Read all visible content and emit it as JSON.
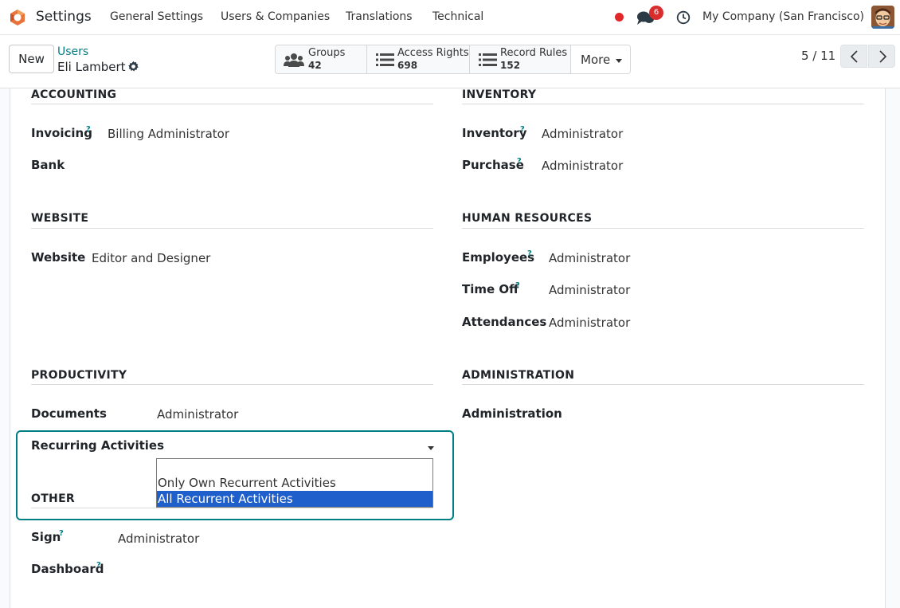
{
  "navbar": {
    "app_name": "Settings",
    "menu": [
      "General Settings",
      "Users & Companies",
      "Translations",
      "Technical"
    ],
    "chat_count": "6",
    "company": "My Company (San Francisco)"
  },
  "control": {
    "new_label": "New",
    "breadcrumb_parent": "Users",
    "breadcrumb_current": "Eli Lambert",
    "smart_buttons": [
      {
        "label": "Groups",
        "count": "42",
        "icon": "users-icon"
      },
      {
        "label": "Access Rights",
        "count": "698",
        "icon": "list-icon"
      },
      {
        "label": "Record Rules",
        "count": "152",
        "icon": "list-icon"
      }
    ],
    "more_label": "More",
    "pager": "5 / 11"
  },
  "sections": {
    "accounting": {
      "title": "ACCOUNTING",
      "fields": [
        {
          "label": "Invoicing",
          "help": "?",
          "value": "Billing Administrator"
        },
        {
          "label": "Bank",
          "help": "",
          "value": ""
        }
      ]
    },
    "inventory": {
      "title": "INVENTORY",
      "fields": [
        {
          "label": "Inventory",
          "help": "?",
          "value": "Administrator"
        },
        {
          "label": "Purchase",
          "help": "?",
          "value": "Administrator"
        }
      ]
    },
    "website": {
      "title": "WEBSITE",
      "fields": [
        {
          "label": "Website",
          "help": "",
          "value": "Editor and Designer"
        }
      ]
    },
    "human_resources": {
      "title": "HUMAN RESOURCES",
      "fields": [
        {
          "label": "Employees",
          "help": "?",
          "value": "Administrator"
        },
        {
          "label": "Time Off",
          "help": "?",
          "value": "Administrator"
        },
        {
          "label": "Attendances",
          "help": "",
          "value": "Administrator"
        }
      ]
    },
    "productivity": {
      "title": "PRODUCTIVITY",
      "fields": [
        {
          "label": "Documents",
          "help": "",
          "value": "Administrator"
        },
        {
          "label": "Recurring Activities",
          "help": "",
          "value": ""
        }
      ]
    },
    "administration": {
      "title": "ADMINISTRATION",
      "fields": [
        {
          "label": "Administration",
          "help": "",
          "value": ""
        }
      ]
    },
    "other": {
      "title": "OTHER",
      "fields": [
        {
          "label": "Sign",
          "help": "?",
          "value": "Administrator"
        },
        {
          "label": "Dashboard",
          "help": "?",
          "value": ""
        }
      ]
    }
  },
  "dropdown": {
    "options": [
      "",
      "Only Own Recurrent Activities",
      "All Recurrent Activities"
    ],
    "highlighted": "All Recurrent Activities"
  },
  "colors": {
    "accent": "#017e84",
    "selection": "#1f5fcc",
    "badge": "#d92d2d"
  }
}
